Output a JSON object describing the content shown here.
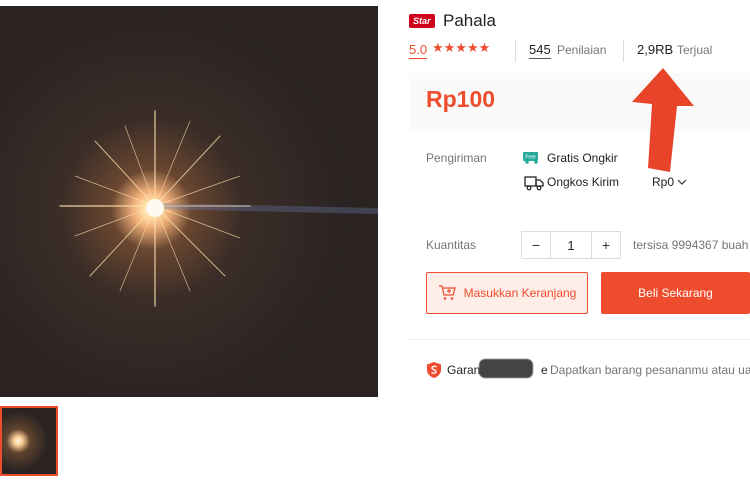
{
  "product": {
    "badge": "Star",
    "title": "Pahala",
    "rating": "5.0",
    "stars": "★★★★★",
    "reviews_count": "545",
    "reviews_label": "Penilaian",
    "sold_count": "2,9RB",
    "sold_label": "Terjual",
    "price": "Rp100"
  },
  "shipping": {
    "label": "Pengiriman",
    "free_badge": "Free",
    "free_text": "Gratis Ongkir",
    "cost_label": "Ongkos Kirim",
    "cost_value": "Rp0"
  },
  "quantity": {
    "label": "Kuantitas",
    "minus": "−",
    "value": "1",
    "plus": "+",
    "stock": "tersisa 9994367 buah"
  },
  "actions": {
    "add_to_cart": "Masukkan Keranjang",
    "buy_now": "Beli Sekarang"
  },
  "guarantee": {
    "label_start": "Garansi",
    "label_end": "e",
    "text": "Dapatkan barang pesananmu atau ua"
  },
  "colors": {
    "accent": "#ee4d2d",
    "arrow": "#e8442a"
  }
}
